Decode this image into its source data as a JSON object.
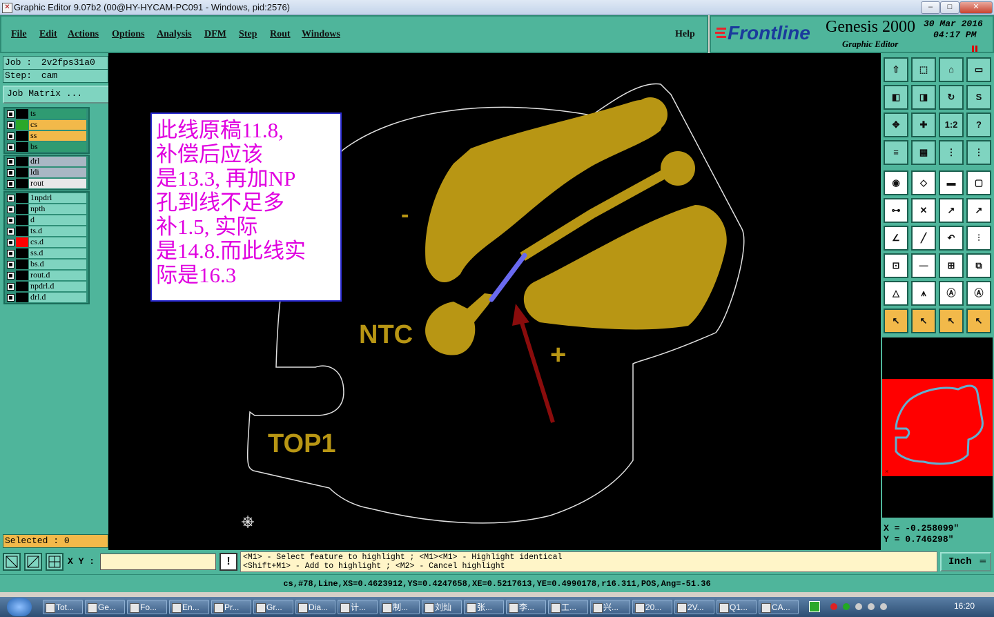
{
  "window": {
    "title": "Graphic Editor 9.07b2 (00@HY-HYCAM-PC091 - Windows, pid:2576)",
    "min_label": "–",
    "max_label": "□",
    "close_label": "✕"
  },
  "menu": {
    "items": [
      "File",
      "Edit",
      "Actions",
      "Options",
      "Analysis",
      "DFM",
      "Step",
      "Rout",
      "Windows"
    ],
    "help": "Help"
  },
  "brand": {
    "logo": "Frontline",
    "product": "Genesis 2000",
    "subtitle": "Graphic Editor",
    "date": "30 Mar 2016",
    "time": "04:17 PM"
  },
  "job": {
    "job_label": "Job :",
    "job_value": "2v2fps31a0",
    "step_label": "Step:",
    "step_value": "cam",
    "matrix_button": "Job Matrix ..."
  },
  "layers": {
    "group1": [
      {
        "name": "ts",
        "color": "#2f9b72",
        "swatch": "#000000"
      },
      {
        "name": "cs",
        "color": "#f2b94a",
        "swatch": "#2aa82a"
      },
      {
        "name": "ss",
        "color": "#f2b94a",
        "swatch": "#000000"
      },
      {
        "name": "bs",
        "color": "#2f9b72",
        "swatch": "#000000"
      }
    ],
    "group2": [
      {
        "name": "drl",
        "color": "#a9b7c4",
        "swatch": "#000000"
      },
      {
        "name": "ldi",
        "color": "#a9b7c4",
        "swatch": "#000000"
      },
      {
        "name": "rout",
        "color": "#e8e8e8",
        "swatch": "#000000"
      }
    ],
    "group3": [
      {
        "name": "1npdrl",
        "color": "#7fd4c0",
        "swatch": "#000000"
      },
      {
        "name": "npth",
        "color": "#7fd4c0",
        "swatch": "#000000"
      },
      {
        "name": "d",
        "color": "#7fd4c0",
        "swatch": "#000000"
      },
      {
        "name": "ts.d",
        "color": "#7fd4c0",
        "swatch": "#000000"
      },
      {
        "name": "cs.d",
        "color": "#7fd4c0",
        "swatch": "#ff0000"
      },
      {
        "name": "ss.d",
        "color": "#7fd4c0",
        "swatch": "#000000"
      },
      {
        "name": "bs.d",
        "color": "#7fd4c0",
        "swatch": "#000000"
      },
      {
        "name": "rout.d",
        "color": "#7fd4c0",
        "swatch": "#000000"
      },
      {
        "name": "npdrl.d",
        "color": "#7fd4c0",
        "swatch": "#000000"
      },
      {
        "name": "drl.d",
        "color": "#7fd4c0",
        "swatch": "#000000"
      }
    ]
  },
  "selected": "Selected : 0",
  "canvas": {
    "annotation_lines": [
      "此线原稿11.8,",
      "补偿后应该",
      "是13.3, 再加NP",
      "孔到线不足多",
      "补1.5, 实际",
      "是14.8.而此线实",
      "际是16.3"
    ],
    "labels": {
      "minus": "-",
      "plus": "+",
      "ntc": "NTC",
      "top1": "TOP1"
    },
    "colors": {
      "copper": "#b89614",
      "outline": "#e0e0e0",
      "highlight": "#6a6af0",
      "arrow": "#8a0c0c",
      "annotation_text": "#e000e0"
    }
  },
  "coords": {
    "x": "X  = -0.258099\"",
    "y": "Y  = 0.746298\""
  },
  "bottom": {
    "xy_label": "X Y :",
    "xy_value": "",
    "hint_line1": "<M1> - Select feature to highlight ; <M1><M1> - Highlight identical",
    "hint_line2": "<Shift+M1> - Add to highlight ; <M2> - Cancel highlight",
    "units": "Inch",
    "status": "cs,#78,Line,XS=0.4623912,YS=0.4247658,XE=0.5217613,YE=0.4990178,r16.311,POS,Ang=-51.36"
  },
  "taskbar": {
    "items": [
      "Tot...",
      "Ge...",
      "Fo...",
      "En...",
      "Pr...",
      "Gr...",
      "Dia...",
      "计...",
      "制...",
      "刘灿",
      "张...",
      "李...",
      "工...",
      "兴...",
      "20...",
      "2V...",
      "Q1...",
      "CA..."
    ],
    "clock": "16:20"
  }
}
